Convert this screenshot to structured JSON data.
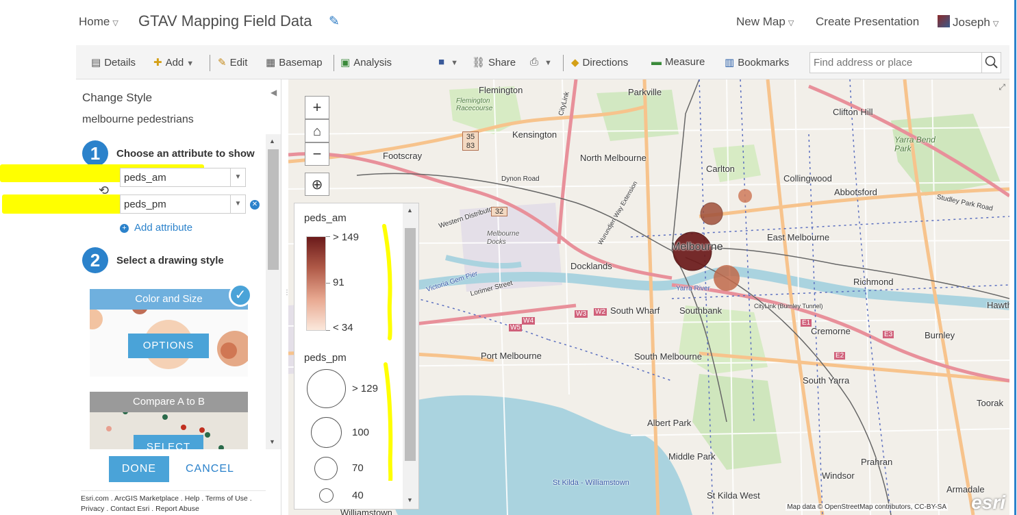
{
  "header": {
    "home_label": "Home",
    "title": "GTAV Mapping Field Data",
    "new_map_label": "New Map",
    "create_presentation_label": "Create Presentation",
    "user_name": "Joseph"
  },
  "toolbar": {
    "details": "Details",
    "add": "Add",
    "edit": "Edit",
    "basemap": "Basemap",
    "analysis": "Analysis",
    "share": "Share",
    "directions": "Directions",
    "measure": "Measure",
    "bookmarks": "Bookmarks",
    "search_placeholder": "Find address or place"
  },
  "panel": {
    "title": "Change Style",
    "layer_name": "melbourne pedestrians",
    "step1": {
      "number": "1",
      "label": "Choose an attribute to show"
    },
    "attributes": [
      "peds_am",
      "peds_pm"
    ],
    "add_attribute": "Add attribute",
    "step2": {
      "number": "2",
      "label": "Select a drawing style"
    },
    "styles": [
      {
        "name": "Color and Size",
        "button": "OPTIONS",
        "selected": true
      },
      {
        "name": "Compare A to B",
        "button": "SELECT",
        "selected": false
      }
    ],
    "done": "DONE",
    "cancel": "CANCEL",
    "footer_links": [
      "Esri.com",
      "ArcGIS Marketplace",
      "Help",
      "Terms of Use",
      "Privacy",
      "Contact Esri",
      "Report Abuse"
    ]
  },
  "legend": {
    "color_field": "peds_am",
    "color_stops": [
      "> 149",
      "91",
      "< 34"
    ],
    "size_field": "peds_pm",
    "size_stops": [
      "> 129",
      "100",
      "70",
      "40"
    ]
  },
  "map": {
    "labels": [
      "Flemington",
      "Parkville",
      "Flemington Racecourse",
      "Kensington",
      "Clifton Hill",
      "Yarra Bend Park",
      "Footscray",
      "North Melbourne",
      "Carlton",
      "Collingwood",
      "Abbotsford",
      "Melbourne",
      "East Melbourne",
      "Melbourne Docks",
      "Docklands",
      "Richmond",
      "South Wharf",
      "Southbank",
      "Cremorne",
      "Burnley",
      "Port Melbourne",
      "South Melbourne",
      "South Yarra",
      "Toorak",
      "Albert Park",
      "Middle Park",
      "Prahran",
      "Windsor",
      "St Kilda West",
      "St Kilda - Williamstown",
      "Williamstown",
      "Armadale",
      "Hawth",
      "Dynon Road",
      "Western Distributor",
      "CityLink",
      "Lorimer Street",
      "Studley Park Road",
      "Yarra River",
      "Victoria Gem Pier",
      "Wurundjeri Way Extension",
      "CityLink (Burnley Tunnel)"
    ],
    "attribution": "Map data © OpenStreetMap contributors, CC-BY-SA",
    "logo": "esri",
    "route_shields": [
      "35 83",
      "32",
      "W5",
      "W4",
      "W3",
      "W2",
      "E1",
      "E2",
      "E3"
    ]
  },
  "colors": {
    "accent": "#2b82cb",
    "button": "#4aa3d8",
    "highlight": "#ffff00",
    "ramp_high": "#6b1a1a",
    "ramp_low": "#fbe8dc"
  }
}
